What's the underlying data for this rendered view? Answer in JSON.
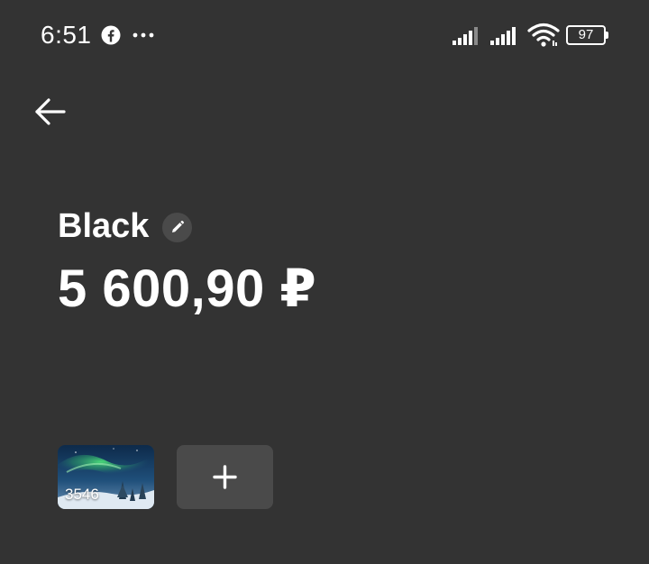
{
  "status_bar": {
    "time": "6:51",
    "battery_level": "97",
    "icons": [
      "facebook-icon",
      "more-dots-icon",
      "signal-icon",
      "signal-icon",
      "wifi-icon",
      "battery-icon"
    ]
  },
  "nav": {
    "back_icon": "arrow-left-icon"
  },
  "account": {
    "name": "Black",
    "edit_icon": "pencil-icon",
    "balance": "5 600,90 ₽"
  },
  "cards": {
    "items": [
      {
        "number": "3546",
        "image": "aurora-night-landscape"
      }
    ],
    "add_icon": "plus-icon"
  },
  "colors": {
    "background": "#333333",
    "text": "#ffffff",
    "button_bg": "#4a4a4a"
  }
}
